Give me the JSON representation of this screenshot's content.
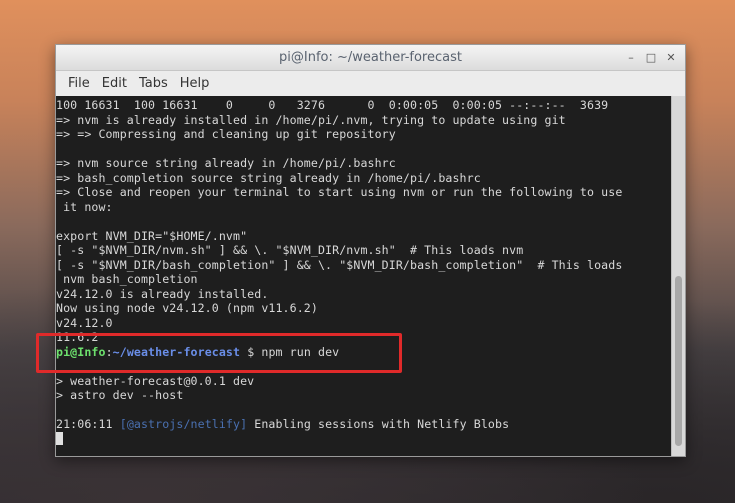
{
  "window": {
    "title": "pi@Info: ~/weather-forecast"
  },
  "menu": {
    "items": [
      "File",
      "Edit",
      "Tabs",
      "Help"
    ]
  },
  "terminal": {
    "lines": [
      "100 16631  100 16631    0     0   3276      0  0:00:05  0:00:05 --:--:--  3639",
      "=> nvm is already installed in /home/pi/.nvm, trying to update using git",
      "=> => Compressing and cleaning up git repository",
      "",
      "=> nvm source string already in /home/pi/.bashrc",
      "=> bash_completion source string already in /home/pi/.bashrc",
      "=> Close and reopen your terminal to start using nvm or run the following to use",
      " it now:",
      "",
      "export NVM_DIR=\"$HOME/.nvm\"",
      "[ -s \"$NVM_DIR/nvm.sh\" ] && \\. \"$NVM_DIR/nvm.sh\"  # This loads nvm",
      "[ -s \"$NVM_DIR/bash_completion\" ] && \\. \"$NVM_DIR/bash_completion\"  # This loads",
      " nvm bash_completion",
      "v24.12.0 is already installed.",
      "Now using node v24.12.0 (npm v11.6.2)",
      "v24.12.0",
      "11.6.2"
    ],
    "prompt": {
      "user": "pi@Info",
      "separator": ":",
      "path": "~/weather-forecast",
      "symbol": " $ ",
      "command": "npm run dev"
    },
    "lines_after": [
      "",
      "> weather-forecast@0.0.1 dev",
      "> astro dev --host",
      "",
      ""
    ],
    "log": {
      "time": "21:06:11 ",
      "tag": "[@astrojs/netlify]",
      "message": " Enabling sessions with Netlify Blobs"
    }
  },
  "colors": {
    "highlight_box": "#e02a2a",
    "prompt_user": "#6de06d",
    "prompt_path": "#6a8ee8",
    "terminal_bg": "#1e1e1e"
  }
}
